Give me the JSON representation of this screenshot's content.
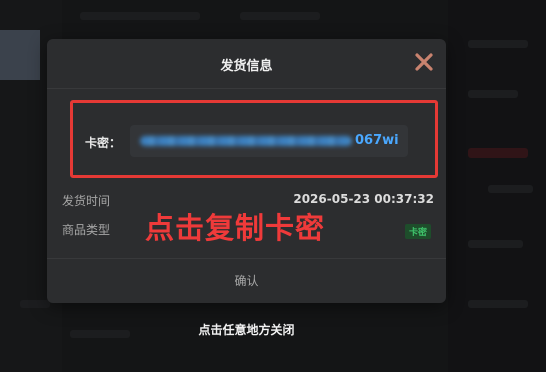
{
  "modal": {
    "title": "发货信息",
    "close_icon": "close-icon",
    "key": {
      "label": "卡密：",
      "visible_suffix": "067wi"
    },
    "rows": [
      {
        "label": "发货时间",
        "value": "2026-05-23 00:37:32"
      },
      {
        "label": "商品类型",
        "badge": "卡密"
      }
    ],
    "confirm_label": "确认"
  },
  "annotation": "点击复制卡密",
  "dismiss_hint": "点击任意地方关闭",
  "colors": {
    "highlight_border": "#e53935",
    "annotation_text": "#ef3a3a",
    "key_text": "#4aa8ff",
    "badge_text": "#3fc36b",
    "badge_bg": "#1e4d2b",
    "close_icon": "#c9836f"
  }
}
